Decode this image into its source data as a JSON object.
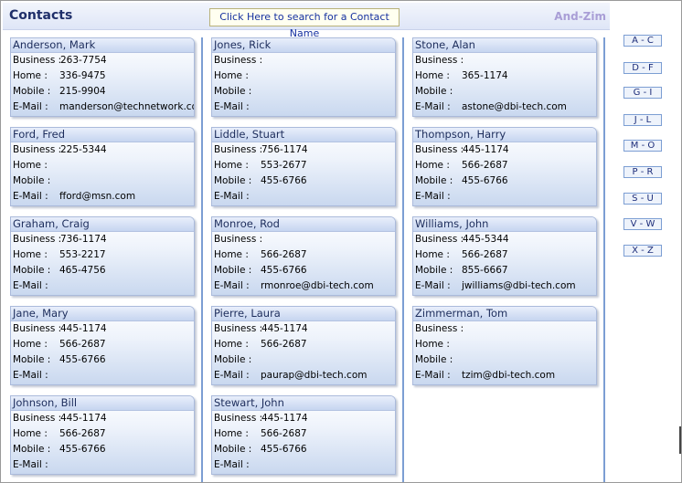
{
  "header": {
    "title": "Contacts",
    "search_button": "Click Here to search for a Contact Name",
    "range_label": "And-Zim"
  },
  "alpha_index": [
    "A - C",
    "D - F",
    "G - I",
    "J - L",
    "M - O",
    "P - R",
    "S - U",
    "V - W",
    "X - Z"
  ],
  "labels": {
    "business": "Business :",
    "home": "Home :",
    "mobile": "Mobile :",
    "email": "E-Mail :"
  },
  "contacts": [
    {
      "name": "Anderson, Mark",
      "business": "263-7754",
      "home": "336-9475",
      "mobile": "215-9904",
      "email": "manderson@technetwork.com"
    },
    {
      "name": "Ford, Fred",
      "business": "225-5344",
      "home": "",
      "mobile": "",
      "email": "fford@msn.com"
    },
    {
      "name": "Graham, Craig",
      "business": "736-1174",
      "home": "553-2217",
      "mobile": "465-4756",
      "email": ""
    },
    {
      "name": "Jane, Mary",
      "business": "445-1174",
      "home": "566-2687",
      "mobile": "455-6766",
      "email": ""
    },
    {
      "name": "Johnson, Bill",
      "business": "445-1174",
      "home": "566-2687",
      "mobile": "455-6766",
      "email": ""
    },
    {
      "name": "Jones, Rick",
      "business": "",
      "home": "",
      "mobile": "",
      "email": ""
    },
    {
      "name": "Liddle, Stuart",
      "business": "756-1174",
      "home": "553-2677",
      "mobile": "455-6766",
      "email": ""
    },
    {
      "name": "Monroe, Rod",
      "business": "",
      "home": "566-2687",
      "mobile": "455-6766",
      "email": "rmonroe@dbi-tech.com"
    },
    {
      "name": "Pierre, Laura",
      "business": "445-1174",
      "home": "566-2687",
      "mobile": "",
      "email": "paurap@dbi-tech.com"
    },
    {
      "name": "Stewart, John",
      "business": "445-1174",
      "home": "566-2687",
      "mobile": "455-6766",
      "email": ""
    },
    {
      "name": "Stone, Alan",
      "business": "",
      "home": "365-1174",
      "mobile": "",
      "email": "astone@dbi-tech.com"
    },
    {
      "name": "Thompson, Harry",
      "business": "445-1174",
      "home": "566-2687",
      "mobile": "455-6766",
      "email": ""
    },
    {
      "name": "Williams, John",
      "business": "445-5344",
      "home": "566-2687",
      "mobile": "855-6667",
      "email": "jwilliams@dbi-tech.com"
    },
    {
      "name": "Zimmerman, Tom",
      "business": "",
      "home": "",
      "mobile": "",
      "email": "tzim@dbi-tech.com"
    }
  ]
}
